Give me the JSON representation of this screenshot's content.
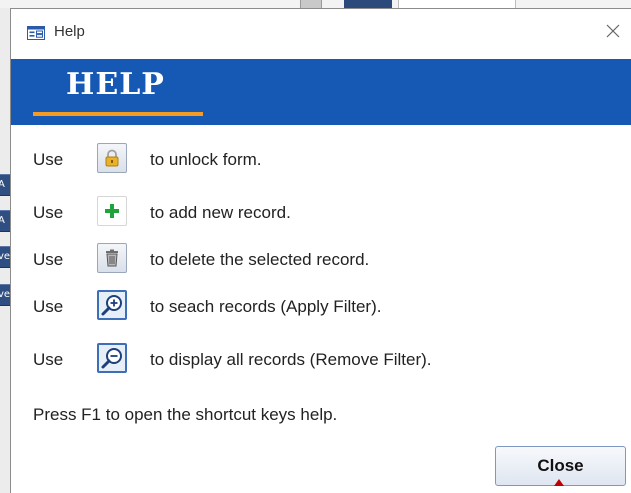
{
  "window": {
    "title": "Help",
    "icon": "form-icon",
    "close_icon": "close-icon"
  },
  "header": {
    "title": "HELP",
    "band_color": "#1559b5",
    "underline_color": "#f59a23"
  },
  "rows": [
    {
      "prefix": "Use",
      "icon": "lock-icon",
      "text": "to unlock form."
    },
    {
      "prefix": "Use",
      "icon": "plus-icon",
      "text": "to add new record."
    },
    {
      "prefix": "Use",
      "icon": "trash-icon",
      "text": "to delete the selected record."
    },
    {
      "prefix": "Use",
      "icon": "zoom-in-icon",
      "text": "to seach records (Apply Filter)."
    },
    {
      "prefix": "Use",
      "icon": "zoom-out-icon",
      "text": "to display all records (Remove Filter)."
    }
  ],
  "footer_note": "Press F1 to open the shortcut keys help.",
  "close_button": {
    "label": "Close"
  }
}
